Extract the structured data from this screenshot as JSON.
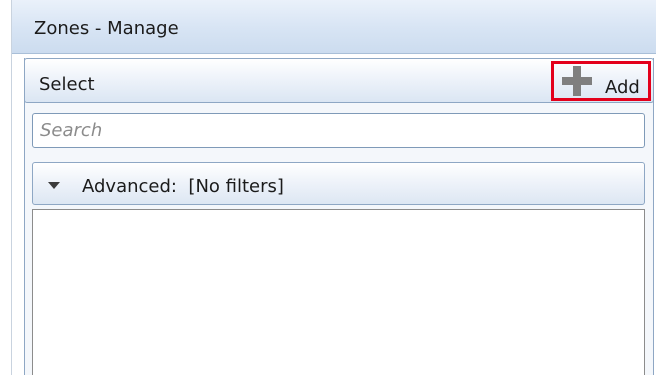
{
  "window": {
    "title": "Zones - Manage"
  },
  "panel": {
    "title": "Select",
    "add_label": "Add",
    "add_icon": "plus-icon"
  },
  "search": {
    "placeholder": "Search",
    "value": ""
  },
  "advanced": {
    "label": "Advanced:  [No filters]",
    "expander_icon": "chevron-down-icon"
  },
  "list": {
    "items": []
  },
  "colors": {
    "titlebar": "#d7e4f4",
    "border": "#8ea7c4",
    "highlight": "#e3001b"
  }
}
